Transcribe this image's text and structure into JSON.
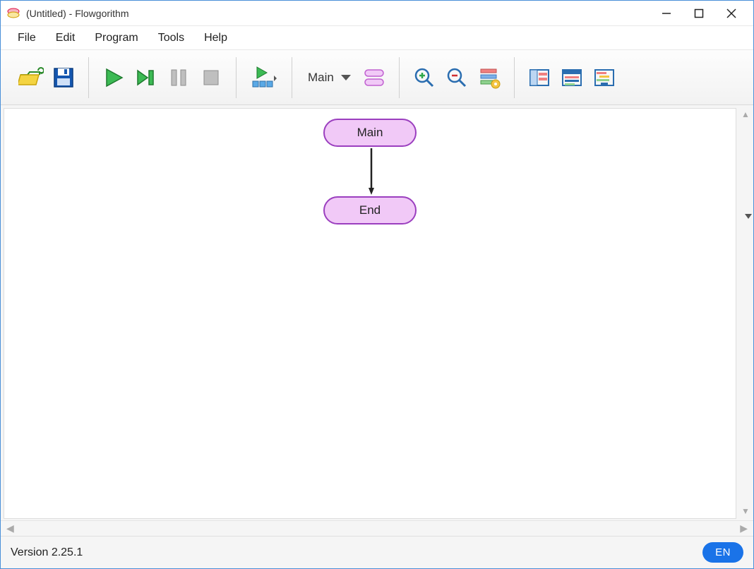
{
  "window": {
    "title": "(Untitled) - Flowgorithm"
  },
  "menu": {
    "file": "File",
    "edit": "Edit",
    "program": "Program",
    "tools": "Tools",
    "help": "Help"
  },
  "toolbar": {
    "function_selected": "Main"
  },
  "flowchart": {
    "start_label": "Main",
    "end_label": "End"
  },
  "status": {
    "version": "Version 2.25.1",
    "language": "EN"
  }
}
